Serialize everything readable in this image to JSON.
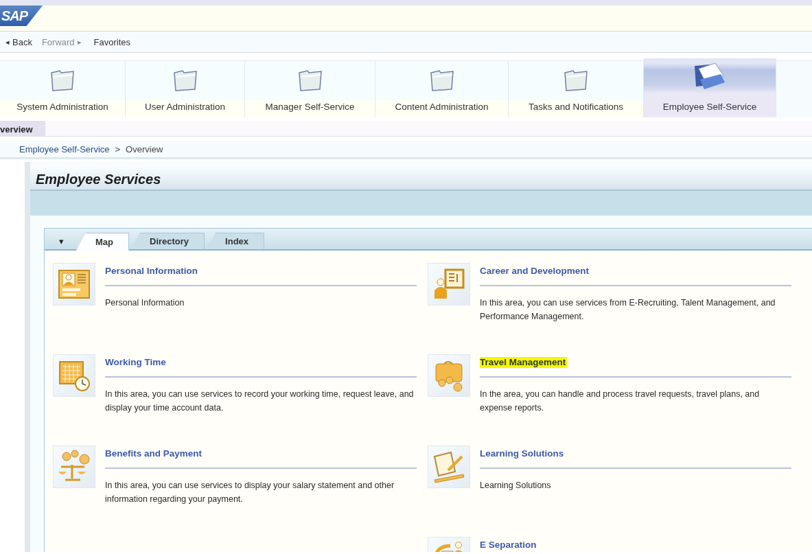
{
  "header": {
    "logo": "SAP"
  },
  "history": [
    {
      "label": "Back",
      "arrow": "◂",
      "disabled": false
    },
    {
      "label": "Forward",
      "arrow": "▸",
      "disabled": true
    },
    {
      "label": "Favorites",
      "disabled": false
    }
  ],
  "top_tabs": [
    {
      "label": "System Administration",
      "selected": false
    },
    {
      "label": "User Administration",
      "selected": false
    },
    {
      "label": "Manager Self-Service",
      "selected": false
    },
    {
      "label": "Content Administration",
      "selected": false
    },
    {
      "label": "Tasks and Notifications",
      "selected": false
    },
    {
      "label": "Employee Self-Service",
      "selected": true
    }
  ],
  "sub_tabs": [
    {
      "label": "verview",
      "selected": true
    }
  ],
  "breadcrumb": {
    "items": [
      "Employee Self-Service",
      "Overview"
    ],
    "separator": ">"
  },
  "panel": {
    "title": "Employee Services",
    "view_menu": "▾",
    "tabs": [
      {
        "label": "Map",
        "selected": true
      },
      {
        "label": "Directory",
        "selected": false
      },
      {
        "label": "Index",
        "selected": false
      }
    ],
    "columns": [
      [
        {
          "title": "Personal Information",
          "description": "Personal Information",
          "highlighted": false
        },
        {
          "title": "Working Time",
          "description": "In this area, you can use services to record your working time, request leave, and display your time account data.",
          "highlighted": false
        },
        {
          "title": "Benefits and Payment",
          "description": "In this area, you can use services to display your salary statement and other information regarding your payment.",
          "highlighted": false
        }
      ],
      [
        {
          "title": "Career and Development",
          "description": "In this area, you can use services from E-Recruiting, Talent Management, and Performance Management.",
          "highlighted": false
        },
        {
          "title": "Travel Management",
          "description": "In the area, you can handle and process travel requests, travel plans, and expense reports.",
          "highlighted": true
        },
        {
          "title": "Learning Solutions",
          "description": "Learning Solutions",
          "highlighted": false
        },
        {
          "title": "E Separation",
          "highlighted": false
        }
      ]
    ]
  }
}
